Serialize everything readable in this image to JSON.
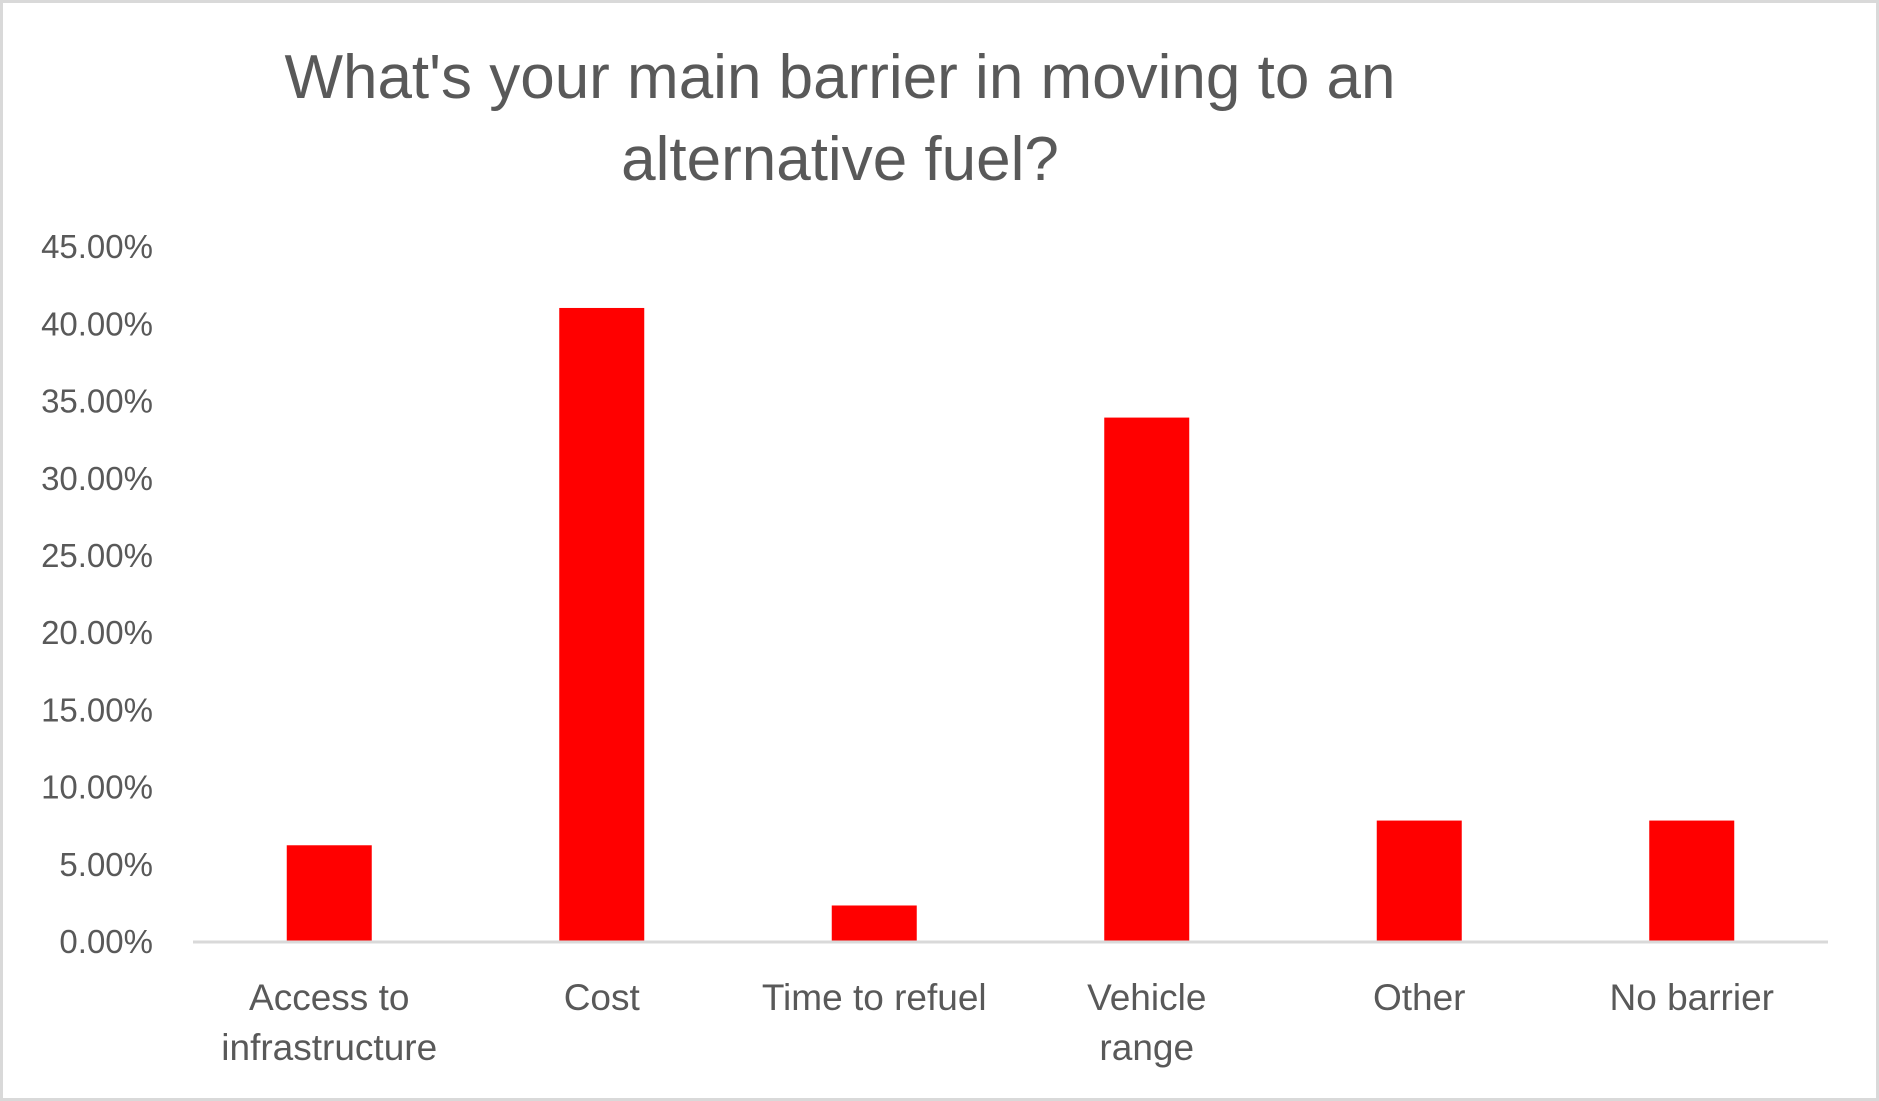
{
  "chart_data": {
    "type": "bar",
    "title": "What's your main barrier in moving to an alternative fuel?",
    "title_lines": [
      "What's your main barrier in moving to an",
      "alternative fuel?"
    ],
    "xlabel": "",
    "ylabel": "",
    "categories": [
      "Access to infrastructure",
      "Cost",
      "Time to refuel",
      "Vehicle range",
      "Other",
      "No barrier"
    ],
    "category_lines": [
      [
        "Access to",
        "infrastructure"
      ],
      [
        "Cost"
      ],
      [
        "Time to refuel"
      ],
      [
        "Vehicle",
        "range"
      ],
      [
        "Other"
      ],
      [
        "No barrier"
      ]
    ],
    "values": [
      6.2,
      41.0,
      2.3,
      33.9,
      7.8,
      7.8
    ],
    "value_unit": "%",
    "ylim": [
      0,
      45
    ],
    "yticks": [
      0,
      5,
      10,
      15,
      20,
      25,
      30,
      35,
      40,
      45
    ],
    "ytick_labels": [
      "0.00%",
      "5.00%",
      "10.00%",
      "15.00%",
      "20.00%",
      "25.00%",
      "30.00%",
      "35.00%",
      "40.00%",
      "45.00%"
    ],
    "grid": false,
    "legend": "none",
    "colors": {
      "bar": "#ff0000",
      "text": "#595959",
      "axis": "#d9d9d9",
      "border": "#d9d9d9"
    }
  }
}
